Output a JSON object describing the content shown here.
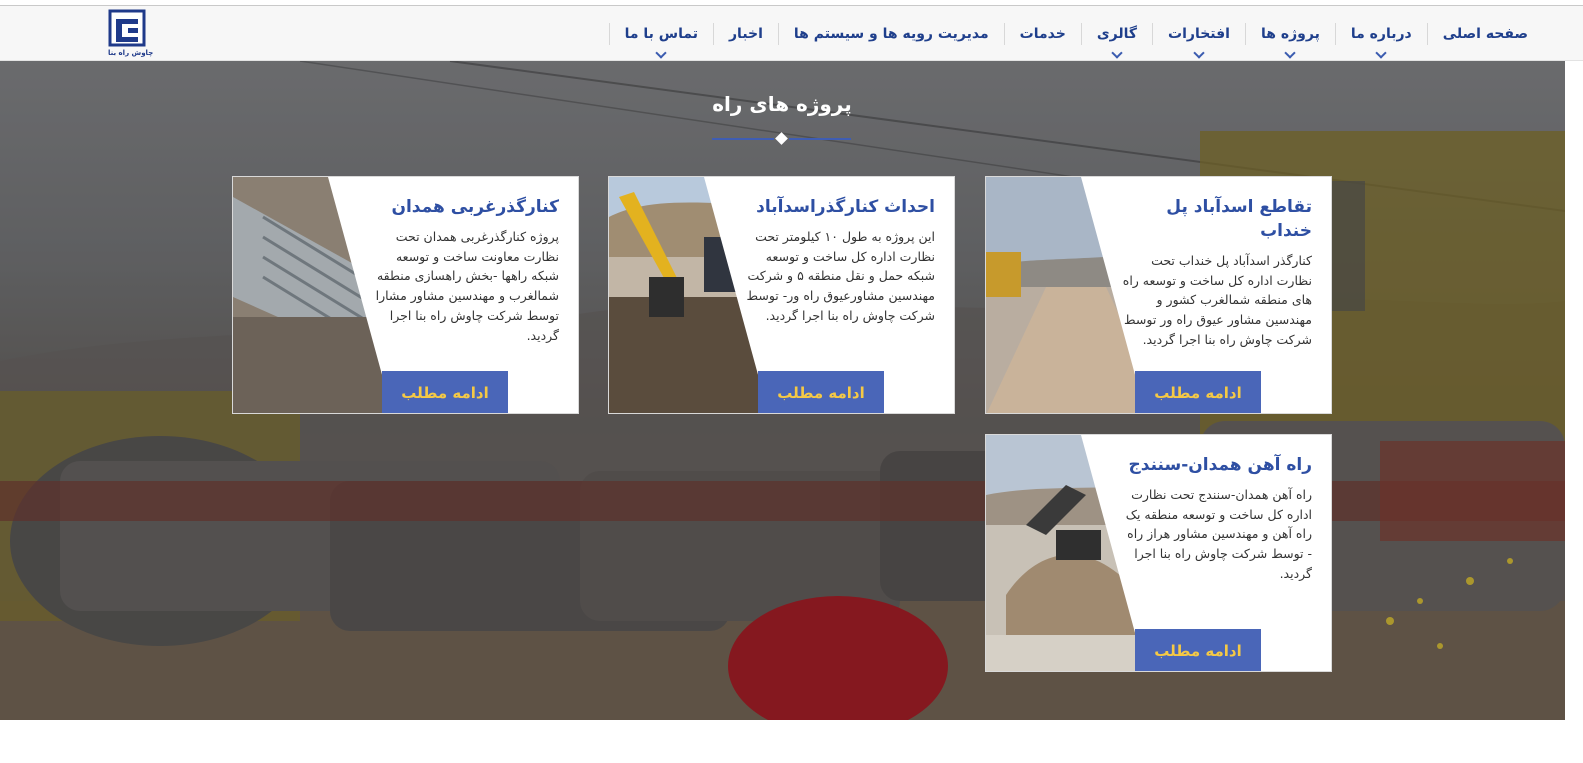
{
  "brand": {
    "logo_text": "چاوش راه بنا"
  },
  "nav": {
    "items": [
      {
        "label": "صفحه اصلی"
      },
      {
        "label": "درباره ما"
      },
      {
        "label": "پروژه ها"
      },
      {
        "label": "افتخارات"
      },
      {
        "label": "گالری"
      },
      {
        "label": "خدمات"
      },
      {
        "label": "مدیریت رویه ها و سیستم ها"
      },
      {
        "label": "اخبار"
      },
      {
        "label": "تماس با ما"
      }
    ]
  },
  "section": {
    "title": "پروژه های راه"
  },
  "cards": [
    {
      "title": "تقاطع اسدآباد پل خنداب",
      "desc": "کنارگذر اسدآباد پل خنداب تحت نظارت اداره کل ساخت و توسعه راه های منطقه شمالغرب کشور و مهندسین مشاور عیوق راه ور توسط شرکت چاوش راه بنا اجرا گردید.",
      "button": "ادامه مطلب",
      "image": "road-roller-photo"
    },
    {
      "title": "احداث کنارگذراسدآباد",
      "desc": "این پروژه به طول ۱۰ کیلومتر تحت نظارت اداره کل ساخت و توسعه شبکه حمل و نقل منطقه ۵ و شرکت مهندسین مشاورعیوق راه ور- توسط شرکت چاوش راه بنا اجرا گردید.",
      "button": "ادامه مطلب",
      "image": "excavator-photo"
    },
    {
      "title": "کنارگذرغربی همدان",
      "desc": "پروژه کنارگذرغربی همدان تحت نظارت معاونت ساخت و توسعه شبکه راهها -بخش راهسازی منطقه شمالغرب و مهندسین مشاور مشارا توسط شرکت چاوش راه بنا اجرا گردید.",
      "button": "ادامه مطلب",
      "image": "retaining-wall-photo"
    },
    {
      "title": "راه آهن همدان-سنندج",
      "desc": "راه آهن همدان-سنندج تحت نظارت اداره کل ساخت و توسعه منطقه یک راه آهن و مهندسین مشاور هراز راه - توسط شرکت چاوش راه بنا اجرا گردید.",
      "button": "ادامه مطلب",
      "image": "railway-excavator-photo"
    }
  ],
  "colors": {
    "nav_text": "#1f3f8c",
    "card_title": "#2e4fa3",
    "button_bg": "#4a66b8",
    "button_text": "#f5c945",
    "divider": "#3f5db3"
  }
}
